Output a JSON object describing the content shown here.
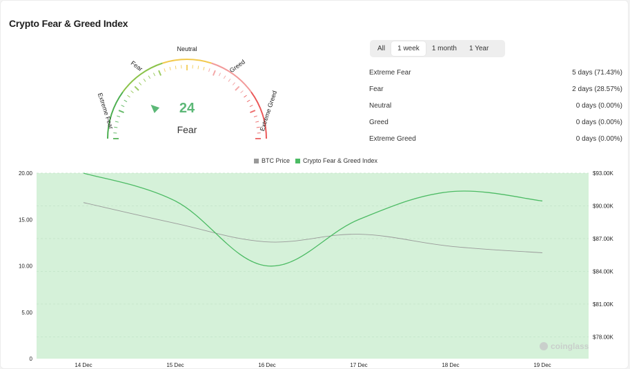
{
  "title": "Crypto Fear & Greed Index",
  "gauge": {
    "value": "24",
    "label": "Fear",
    "zones": [
      "Extreme Fear",
      "Fear",
      "Neutral",
      "Greed",
      "Extreme Greed"
    ],
    "colors": [
      "#4caf50",
      "#8bc34a",
      "#f2c94c",
      "#f29a9a",
      "#eb5757"
    ]
  },
  "tabs": [
    "All",
    "1 week",
    "1 month",
    "1 Year"
  ],
  "active_tab": "1 week",
  "stats": [
    {
      "label": "Extreme Fear",
      "value": "5 days (71.43%)"
    },
    {
      "label": "Fear",
      "value": "2 days (28.57%)"
    },
    {
      "label": "Neutral",
      "value": "0 days (0.00%)"
    },
    {
      "label": "Greed",
      "value": "0 days (0.00%)"
    },
    {
      "label": "Extreme Greed",
      "value": "0 days (0.00%)"
    }
  ],
  "watermark": "coinglass",
  "chart_data": {
    "type": "line",
    "title": "",
    "x": [
      "14 Dec",
      "15 Dec",
      "16 Dec",
      "17 Dec",
      "18 Dec",
      "19 Dec"
    ],
    "y_left": {
      "range": [
        0,
        20
      ],
      "ticks": [
        "0",
        "5.00",
        "10.00",
        "15.00",
        "20.00"
      ]
    },
    "y_right": {
      "range": [
        76000,
        93000
      ],
      "ticks": [
        "$78.00K",
        "$81.00K",
        "$84.00K",
        "$87.00K",
        "$90.00K",
        "$93.00K"
      ]
    },
    "series": [
      {
        "name": "BTC Price",
        "axis": "right",
        "color": "#999999",
        "values": [
          90300,
          88400,
          86700,
          87400,
          86300,
          85700
        ]
      },
      {
        "name": "Crypto Fear & Greed Index",
        "axis": "left",
        "color": "#4cbb64",
        "values": [
          20,
          17,
          10,
          15,
          18,
          17
        ]
      }
    ],
    "background_color": "#d5f1d9",
    "grid": true,
    "legend_position": "top"
  }
}
